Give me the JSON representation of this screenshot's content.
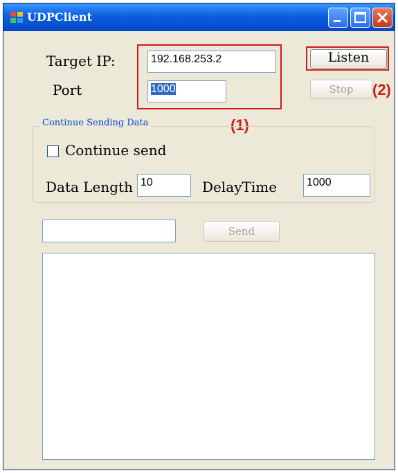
{
  "window": {
    "title": "UDPClient"
  },
  "connection": {
    "target_ip_label": "Target IP:",
    "target_ip_value": "192.168.253.2",
    "port_label": "Port",
    "port_value": "1000",
    "listen_label": "Listen",
    "stop_label": "Stop"
  },
  "annotations": {
    "box1": "(1)",
    "box2": "(2)"
  },
  "continue_group": {
    "legend": "Continue Sending Data",
    "checkbox_label": "Continue send",
    "checked": false,
    "data_length_label": "Data Length",
    "data_length_value": "10",
    "delay_time_label": "DelayTime",
    "delay_time_value": "1000"
  },
  "send": {
    "message_value": "",
    "send_label": "Send"
  },
  "colors": {
    "title_bar": "#0a5fe0",
    "annotation": "#d11a1a",
    "group_legend": "#0046d5"
  },
  "icons": [
    "app-icon",
    "minimize-icon",
    "maximize-icon",
    "close-icon"
  ]
}
